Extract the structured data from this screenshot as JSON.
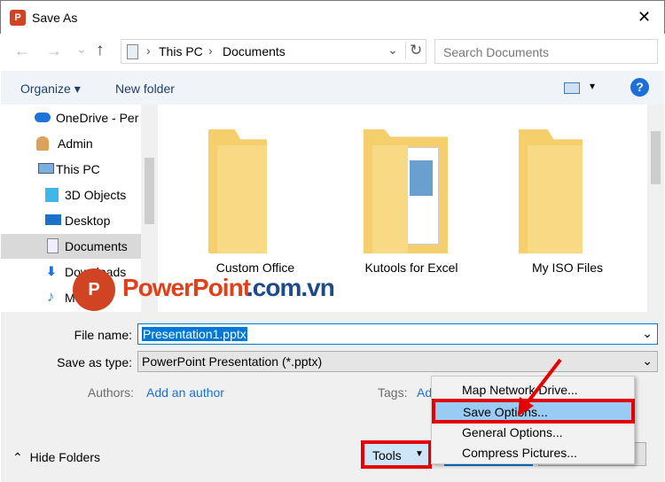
{
  "window": {
    "title": "Save As",
    "close": "✕"
  },
  "nav": {
    "back": "←",
    "forward": "→",
    "recent": "⌄",
    "up": "↑",
    "breadcrumb": [
      "This PC",
      "Documents"
    ],
    "sep": "›",
    "refresh": "↻",
    "dropdown": "⌄",
    "search_placeholder": "Search Documents"
  },
  "toolbar": {
    "organize": "Organize ▾",
    "new_folder": "New folder",
    "view": "▾",
    "help": "?"
  },
  "sidebar": {
    "items": [
      {
        "label": "OneDrive - Per",
        "icon": "cloud-icon"
      },
      {
        "label": "Admin",
        "icon": "user-icon"
      },
      {
        "label": "This PC",
        "icon": "computer-icon"
      },
      {
        "label": "3D Objects",
        "icon": "cube-icon"
      },
      {
        "label": "Desktop",
        "icon": "desktop-icon"
      },
      {
        "label": "Documents",
        "icon": "document-icon"
      },
      {
        "label": "Downloads",
        "icon": "download-icon"
      },
      {
        "label": "Music",
        "icon": "music-icon"
      }
    ]
  },
  "folders": [
    {
      "name": "Custom Office Templates"
    },
    {
      "name": "Kutools for Excel"
    },
    {
      "name": "My ISO Files"
    }
  ],
  "watermark": {
    "text1": "PowerPoint",
    "text2": ".com.vn"
  },
  "form": {
    "file_name_label": "File name:",
    "file_name_value": "Presentation1.pptx",
    "save_type_label": "Save as type:",
    "save_type_value": "PowerPoint Presentation (*.pptx)",
    "authors_label": "Authors:",
    "authors_value": "Add an author",
    "tags_label": "Tags:",
    "tags_value": "Add a tag"
  },
  "footer": {
    "hide_folders": "Hide Folders",
    "tools": "Tools",
    "tools_arrow": "▼",
    "save": "Save",
    "cancel": "Cancel"
  },
  "menu": {
    "items": [
      "Map Network Drive...",
      "Save Options...",
      "General Options...",
      "Compress Pictures..."
    ],
    "highlight_color": "#99ccf5"
  },
  "colors": {
    "accent": "#0078d7",
    "annotation": "#e60000"
  }
}
